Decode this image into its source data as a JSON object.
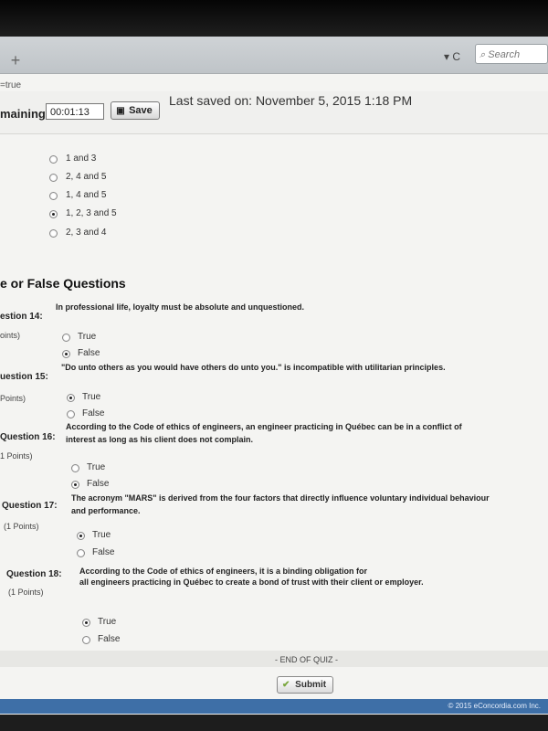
{
  "browser": {
    "new_tab_label": "+",
    "reload_label": "▾ C",
    "search_placeholder": "Search",
    "url_fragment": "=true"
  },
  "timer": {
    "label": "maining:",
    "value": "00:01:13",
    "save_label": "Save",
    "last_saved": "Last saved on: November 5, 2015 1:18 PM"
  },
  "prev_question_options": [
    {
      "label": "1 and 3",
      "selected": false
    },
    {
      "label": "2, 4 and 5",
      "selected": false
    },
    {
      "label": "1, 4 and 5",
      "selected": false
    },
    {
      "label": "1, 2, 3 and 5",
      "selected": true
    },
    {
      "label": "2, 3 and 4",
      "selected": false
    }
  ],
  "section_title": "e or False Questions",
  "questions": [
    {
      "label": "estion 14:",
      "points": "oints)",
      "text": "In professional life, loyalty must be absolute and unquestioned.",
      "options": [
        {
          "label": "True",
          "selected": false
        },
        {
          "label": "False",
          "selected": true
        }
      ]
    },
    {
      "label": "uestion 15:",
      "points": "Points)",
      "text": "\"Do unto others as you would have others do unto you.\" is incompatible with utilitarian principles.",
      "options": [
        {
          "label": "True",
          "selected": true
        },
        {
          "label": "False",
          "selected": false
        }
      ]
    },
    {
      "label": "Question 16:",
      "points": "1 Points)",
      "text_line1": "According to the Code of ethics of engineers, an engineer practicing in Québec can be in a conflict of",
      "text_line2": "interest as long as his client does not complain.",
      "options": [
        {
          "label": "True",
          "selected": false
        },
        {
          "label": "False",
          "selected": true
        }
      ]
    },
    {
      "label": "Question 17:",
      "points": "(1 Points)",
      "text_line1": "The acronym \"MARS\" is derived from the four factors that directly influence voluntary individual behaviour",
      "text_line2": "and performance.",
      "options": [
        {
          "label": "True",
          "selected": true
        },
        {
          "label": "False",
          "selected": false
        }
      ]
    },
    {
      "label": "Question 18:",
      "points": "(1 Points)",
      "text_line1": "According to the Code of ethics of engineers, it is a binding obligation for",
      "text_line2": "all engineers practicing in Québec to create a bond of trust with their client or employer.",
      "options": [
        {
          "label": "True",
          "selected": true
        },
        {
          "label": "False",
          "selected": false
        }
      ]
    }
  ],
  "end_text": "- END OF QUIZ -",
  "submit_label": "Submit",
  "footer_text": "© 2015 eConcordia.com Inc."
}
